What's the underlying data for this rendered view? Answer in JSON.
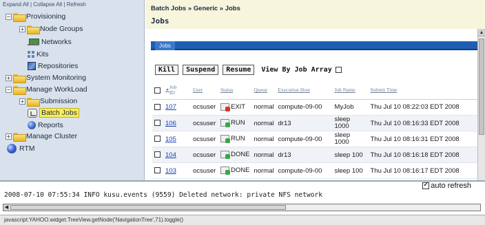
{
  "tree": {
    "toolbar": {
      "expand": "Expand All",
      "collapse": "Collapse All",
      "refresh": "Refresh",
      "sep": "|"
    },
    "nodes": {
      "provisioning": "Provisioning",
      "node_groups": "Node Groups",
      "networks": "Networks",
      "kits": "Kits",
      "repositories": "Repositories",
      "system_monitoring": "System Monitoring",
      "manage_workload": "Manage WorkLoad",
      "submission": "Submission",
      "batch_jobs": "Batch Jobs",
      "reports": "Reports",
      "manage_cluster": "Manage Cluster",
      "rtm": "RTM"
    }
  },
  "main": {
    "breadcrumb": "Batch Jobs » Generic » Jobs",
    "title": "Jobs",
    "section_tab": "Jobs",
    "buttons": {
      "kill": "Kill",
      "suspend": "Suspend",
      "resume": "Resume"
    },
    "view_by_job_array": "View By Job Array",
    "table": {
      "headers": {
        "job_id": "Job ID",
        "user": "User",
        "status": "Status",
        "queue": "Queue",
        "exec_host": "Execution Host",
        "job_name": "Job Name",
        "submit_time": "Submit Time"
      },
      "rows": [
        {
          "id": "107",
          "user": "ocsuser",
          "status": "EXIT",
          "status_kind": "exit",
          "queue": "normal",
          "host": "compute-09-00",
          "name": "MyJob",
          "submit": "Thu Jul 10 08:22:03 EDT 2008"
        },
        {
          "id": "106",
          "user": "ocsuser",
          "status": "RUN",
          "status_kind": "ok",
          "queue": "normal",
          "host": "dr13",
          "name": "sleep 1000",
          "submit": "Thu Jul 10 08:16:33 EDT 2008"
        },
        {
          "id": "105",
          "user": "ocsuser",
          "status": "RUN",
          "status_kind": "ok",
          "queue": "normal",
          "host": "compute-09-00",
          "name": "sleep 1000",
          "submit": "Thu Jul 10 08:16:31 EDT 2008"
        },
        {
          "id": "104",
          "user": "ocsuser",
          "status": "DONE",
          "status_kind": "ok",
          "queue": "normal",
          "host": "dr13",
          "name": "sleep 100",
          "submit": "Thu Jul 10 08:16:18 EDT 2008"
        },
        {
          "id": "103",
          "user": "ocsuser",
          "status": "DONE",
          "status_kind": "ok",
          "queue": "normal",
          "host": "compute-09-00",
          "name": "sleep 100",
          "submit": "Thu Jul 10 08:16:17 EDT 2008"
        }
      ]
    }
  },
  "log": {
    "auto_refresh": "auto refresh",
    "line": "2008-07-10 07:55:34 INFO kusu.events (9559) Deleted network: private NFS network"
  },
  "statusbar": "javascript:YAHOO.widget.TreeView.getNode('NavigationTree',71).toggle()",
  "colors": {
    "tree_bg": "#d9e2ec",
    "breadcrumb_bg": "#f7f5dc",
    "section_bar": "#1f5eb4",
    "selected_highlight": "#f9ee5a"
  }
}
